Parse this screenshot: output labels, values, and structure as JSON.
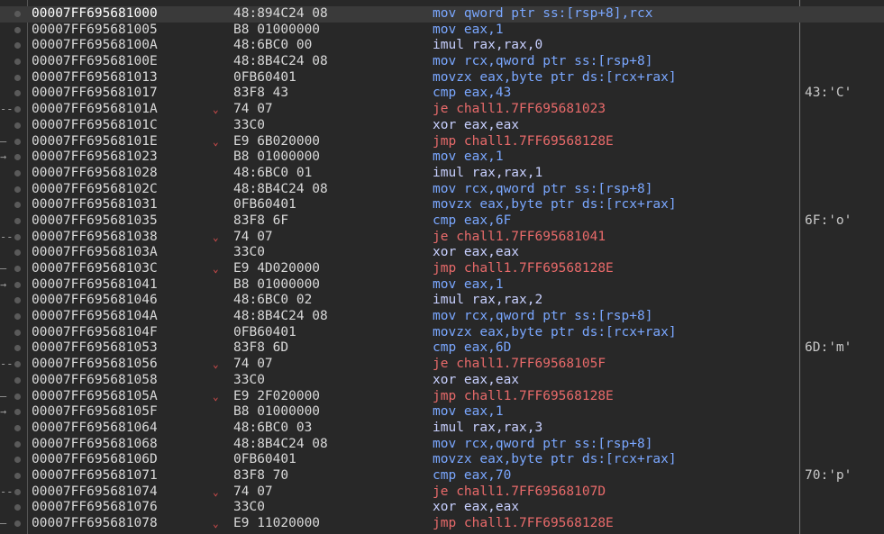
{
  "rows": [
    {
      "addr": "00007FF695681000",
      "bytes": "48:894C24 08",
      "instr": "mov qword ptr ss:[rsp+8],rcx",
      "kind": "mov",
      "comment": "",
      "jump": "",
      "arrow": false,
      "selected": true
    },
    {
      "addr": "00007FF695681005",
      "bytes": "B8 01000000",
      "instr": "mov eax,1",
      "kind": "mov",
      "comment": "",
      "jump": "",
      "arrow": false,
      "selected": false
    },
    {
      "addr": "00007FF69568100A",
      "bytes": "48:6BC0 00",
      "instr": "imul rax,rax,0",
      "kind": "def",
      "comment": "",
      "jump": "",
      "arrow": false,
      "selected": false
    },
    {
      "addr": "00007FF69568100E",
      "bytes": "48:8B4C24 08",
      "instr": "mov rcx,qword ptr ss:[rsp+8]",
      "kind": "mov",
      "comment": "",
      "jump": "",
      "arrow": false,
      "selected": false
    },
    {
      "addr": "00007FF695681013",
      "bytes": "0FB60401",
      "instr": "movzx eax,byte ptr ds:[rcx+rax]",
      "kind": "mov",
      "comment": "",
      "jump": "",
      "arrow": false,
      "selected": false
    },
    {
      "addr": "00007FF695681017",
      "bytes": "83F8 43",
      "instr": "cmp eax,43",
      "kind": "cmp",
      "comment": "43:'C'",
      "jump": "",
      "arrow": false,
      "selected": false
    },
    {
      "addr": "00007FF69568101A",
      "bytes": "74 07",
      "instr": "je chall1.7FF695681023",
      "kind": "jmp",
      "comment": "",
      "jump": "--",
      "arrow": true,
      "selected": false
    },
    {
      "addr": "00007FF69568101C",
      "bytes": "33C0",
      "instr": "xor eax,eax",
      "kind": "def",
      "comment": "",
      "jump": "",
      "arrow": false,
      "selected": false
    },
    {
      "addr": "00007FF69568101E",
      "bytes": "E9 6B020000",
      "instr": "jmp chall1.7FF69568128E",
      "kind": "jmp",
      "comment": "",
      "jump": "—",
      "arrow": true,
      "selected": false
    },
    {
      "addr": "00007FF695681023",
      "bytes": "B8 01000000",
      "instr": "mov eax,1",
      "kind": "mov",
      "comment": "",
      "jump": "→",
      "arrow": false,
      "selected": false
    },
    {
      "addr": "00007FF695681028",
      "bytes": "48:6BC0 01",
      "instr": "imul rax,rax,1",
      "kind": "def",
      "comment": "",
      "jump": "",
      "arrow": false,
      "selected": false
    },
    {
      "addr": "00007FF69568102C",
      "bytes": "48:8B4C24 08",
      "instr": "mov rcx,qword ptr ss:[rsp+8]",
      "kind": "mov",
      "comment": "",
      "jump": "",
      "arrow": false,
      "selected": false
    },
    {
      "addr": "00007FF695681031",
      "bytes": "0FB60401",
      "instr": "movzx eax,byte ptr ds:[rcx+rax]",
      "kind": "mov",
      "comment": "",
      "jump": "",
      "arrow": false,
      "selected": false
    },
    {
      "addr": "00007FF695681035",
      "bytes": "83F8 6F",
      "instr": "cmp eax,6F",
      "kind": "cmp",
      "comment": "6F:'o'",
      "jump": "",
      "arrow": false,
      "selected": false
    },
    {
      "addr": "00007FF695681038",
      "bytes": "74 07",
      "instr": "je chall1.7FF695681041",
      "kind": "jmp",
      "comment": "",
      "jump": "--",
      "arrow": true,
      "selected": false
    },
    {
      "addr": "00007FF69568103A",
      "bytes": "33C0",
      "instr": "xor eax,eax",
      "kind": "def",
      "comment": "",
      "jump": "",
      "arrow": false,
      "selected": false
    },
    {
      "addr": "00007FF69568103C",
      "bytes": "E9 4D020000",
      "instr": "jmp chall1.7FF69568128E",
      "kind": "jmp",
      "comment": "",
      "jump": "—",
      "arrow": true,
      "selected": false
    },
    {
      "addr": "00007FF695681041",
      "bytes": "B8 01000000",
      "instr": "mov eax,1",
      "kind": "mov",
      "comment": "",
      "jump": "→",
      "arrow": false,
      "selected": false
    },
    {
      "addr": "00007FF695681046",
      "bytes": "48:6BC0 02",
      "instr": "imul rax,rax,2",
      "kind": "def",
      "comment": "",
      "jump": "",
      "arrow": false,
      "selected": false
    },
    {
      "addr": "00007FF69568104A",
      "bytes": "48:8B4C24 08",
      "instr": "mov rcx,qword ptr ss:[rsp+8]",
      "kind": "mov",
      "comment": "",
      "jump": "",
      "arrow": false,
      "selected": false
    },
    {
      "addr": "00007FF69568104F",
      "bytes": "0FB60401",
      "instr": "movzx eax,byte ptr ds:[rcx+rax]",
      "kind": "mov",
      "comment": "",
      "jump": "",
      "arrow": false,
      "selected": false
    },
    {
      "addr": "00007FF695681053",
      "bytes": "83F8 6D",
      "instr": "cmp eax,6D",
      "kind": "cmp",
      "comment": "6D:'m'",
      "jump": "",
      "arrow": false,
      "selected": false
    },
    {
      "addr": "00007FF695681056",
      "bytes": "74 07",
      "instr": "je chall1.7FF69568105F",
      "kind": "jmp",
      "comment": "",
      "jump": "--",
      "arrow": true,
      "selected": false
    },
    {
      "addr": "00007FF695681058",
      "bytes": "33C0",
      "instr": "xor eax,eax",
      "kind": "def",
      "comment": "",
      "jump": "",
      "arrow": false,
      "selected": false
    },
    {
      "addr": "00007FF69568105A",
      "bytes": "E9 2F020000",
      "instr": "jmp chall1.7FF69568128E",
      "kind": "jmp",
      "comment": "",
      "jump": "—",
      "arrow": true,
      "selected": false
    },
    {
      "addr": "00007FF69568105F",
      "bytes": "B8 01000000",
      "instr": "mov eax,1",
      "kind": "mov",
      "comment": "",
      "jump": "→",
      "arrow": false,
      "selected": false
    },
    {
      "addr": "00007FF695681064",
      "bytes": "48:6BC0 03",
      "instr": "imul rax,rax,3",
      "kind": "def",
      "comment": "",
      "jump": "",
      "arrow": false,
      "selected": false
    },
    {
      "addr": "00007FF695681068",
      "bytes": "48:8B4C24 08",
      "instr": "mov rcx,qword ptr ss:[rsp+8]",
      "kind": "mov",
      "comment": "",
      "jump": "",
      "arrow": false,
      "selected": false
    },
    {
      "addr": "00007FF69568106D",
      "bytes": "0FB60401",
      "instr": "movzx eax,byte ptr ds:[rcx+rax]",
      "kind": "mov",
      "comment": "",
      "jump": "",
      "arrow": false,
      "selected": false
    },
    {
      "addr": "00007FF695681071",
      "bytes": "83F8 70",
      "instr": "cmp eax,70",
      "kind": "cmp",
      "comment": "70:'p'",
      "jump": "",
      "arrow": false,
      "selected": false
    },
    {
      "addr": "00007FF695681074",
      "bytes": "74 07",
      "instr": "je chall1.7FF69568107D",
      "kind": "jmp",
      "comment": "",
      "jump": "--",
      "arrow": true,
      "selected": false
    },
    {
      "addr": "00007FF695681076",
      "bytes": "33C0",
      "instr": "xor eax,eax",
      "kind": "def",
      "comment": "",
      "jump": "",
      "arrow": false,
      "selected": false
    },
    {
      "addr": "00007FF695681078",
      "bytes": "E9 11020000",
      "instr": "jmp chall1.7FF69568128E",
      "kind": "jmp",
      "comment": "",
      "jump": "—",
      "arrow": true,
      "selected": false
    }
  ],
  "icons": {
    "breakpoint": "breakpoint-dot-icon",
    "branch_arrow": "chevron-down-icon"
  },
  "colors": {
    "background": "#282828",
    "selected_row": "#3a3a3a",
    "mov_cmp": "#7aa7ff",
    "jump": "#e86a6a",
    "arrow": "#e85050"
  }
}
